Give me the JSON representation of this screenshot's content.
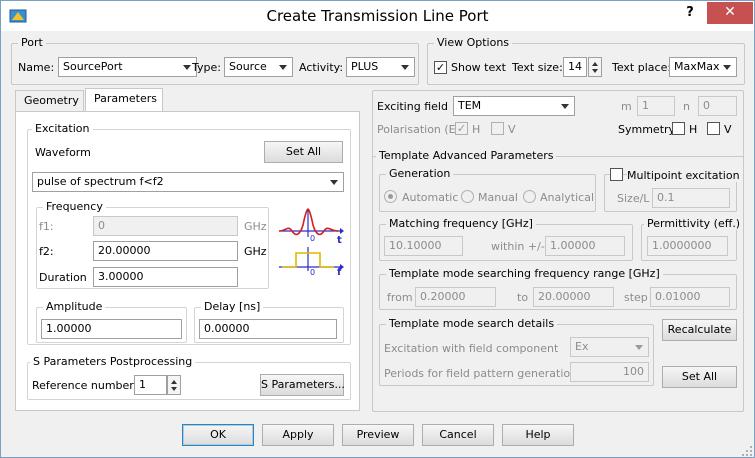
{
  "window": {
    "title": "Create Transmission Line Port",
    "help": "?",
    "close": "✕"
  },
  "port": {
    "group_title": "Port",
    "name_label": "Name:",
    "name_value": "SourcePort",
    "type_label": "Type:",
    "type_value": "Source",
    "activity_label": "Activity:",
    "activity_value": "PLUS"
  },
  "view_options": {
    "group_title": "View Options",
    "show_text_label": "Show text",
    "show_text_checked": "✓",
    "text_size_label": "Text size:",
    "text_size_value": "14",
    "text_place_label": "Text place:",
    "text_place_value": "MaxMax"
  },
  "tabs": [
    {
      "label": "Geometry"
    },
    {
      "label": "Parameters"
    }
  ],
  "excitation": {
    "group_title": "Excitation",
    "waveform_label": "Waveform",
    "set_all": "Set All",
    "waveform_value": "pulse of spectrum f<f2",
    "frequency_title": "Frequency",
    "f1_label": "f1:",
    "f1_value": "0",
    "f1_unit": "GHz",
    "f2_label": "f2:",
    "f2_value": "20.00000",
    "f2_unit": "GHz",
    "duration_label": "Duration",
    "duration_value": "3.00000",
    "amplitude_title": "Amplitude",
    "amplitude_value": "1.00000",
    "delay_title": "Delay [ns]",
    "delay_value": "0.00000",
    "preview_labels": {
      "t": "t",
      "f": "f",
      "o1": "0",
      "o2": "0"
    }
  },
  "s_params": {
    "group_title": "S Parameters Postprocessing",
    "ref_label": "Reference number:",
    "ref_value": "1",
    "button": "S Parameters..."
  },
  "exciting": {
    "field_label": "Exciting field",
    "field_value": "TEM",
    "m_label": "m",
    "m_value": "1",
    "n_label": "n",
    "n_value": "0",
    "polarisation_label": "Polarisation (E)",
    "pol_h_label": "H",
    "pol_h_checked": "✓",
    "pol_v_label": "V",
    "symmetry_label": "Symmetry",
    "sym_h_label": "H",
    "sym_v_label": "V"
  },
  "template": {
    "group_title": "Template Advanced Parameters",
    "generation_title": "Generation",
    "gen_automatic": "Automatic",
    "gen_manual": "Manual",
    "gen_analytical": "Analytical",
    "multipoint_label": "Multipoint excitation",
    "size_label": "Size/L",
    "size_value": "0.1",
    "matching_title": "Matching frequency [GHz]",
    "matching_value": "10.10000",
    "within_label": "within +/-",
    "within_value": "1.00000",
    "permittivity_title": "Permittivity (eff.)",
    "permittivity_value": "1.0000000",
    "range_title": "Template mode searching frequency range [GHz]",
    "from_label": "from",
    "from_value": "0.20000",
    "to_label": "to",
    "to_value": "20.00000",
    "step_label": "step",
    "step_value": "0.01000",
    "details_title": "Template mode search details",
    "excitation_comp_label": "Excitation with field component",
    "excitation_comp_value": "Ex",
    "periods_label": "Periods for field pattern generation",
    "periods_value": "100",
    "recalculate": "Recalculate",
    "set_all": "Set All"
  },
  "footer": {
    "ok": "OK",
    "apply": "Apply",
    "preview": "Preview",
    "cancel": "Cancel",
    "help": "Help"
  },
  "colors": {
    "accent": "#3c7fb1",
    "close": "#c75050"
  }
}
